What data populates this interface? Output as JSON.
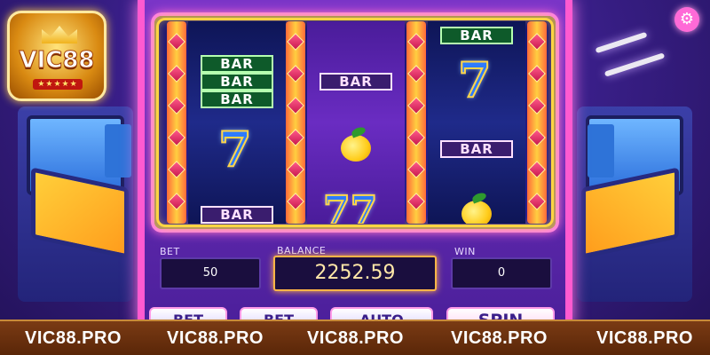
{
  "logo": {
    "text": "VIC88",
    "stars": "★★★★★"
  },
  "settings": {
    "icon": "gear-icon",
    "glyph": "⚙"
  },
  "reels": [
    {
      "symbols": [
        "BAR",
        "BAR",
        "BAR",
        "7",
        "BAR"
      ]
    },
    {
      "symbols": [
        "BAR",
        "lemon",
        "77"
      ]
    },
    {
      "symbols": [
        "BAR",
        "7",
        "BAR",
        "lemon"
      ]
    }
  ],
  "symbol_text": {
    "bar": "BAR",
    "seven": "7",
    "double_seven": "77"
  },
  "panels": {
    "bet_label": "BET",
    "bet_value": "50",
    "balance_label": "BALANCE",
    "balance_value": "2252.59",
    "win_label": "WIN",
    "win_value": "0"
  },
  "buttons": {
    "btn1": "BET",
    "btn2": "BET",
    "btn3": "AUTO",
    "btn4": "SPIN"
  },
  "footer": {
    "watermarks": [
      "VIC88.PRO",
      "VIC88.PRO",
      "VIC88.PRO",
      "VIC88.PRO",
      "VIC88.PRO"
    ]
  },
  "colors": {
    "accent_pink": "#ff5ad0",
    "gold": "#ffd542",
    "footer_brown": "#6a300e",
    "balance_text": "#ffe7a8"
  }
}
